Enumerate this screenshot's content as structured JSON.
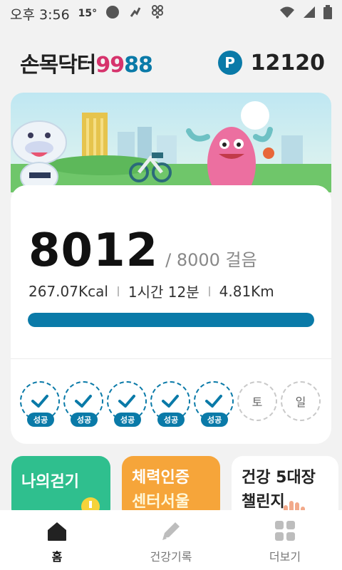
{
  "status_bar": {
    "time": "오후 3:56",
    "temperature": "15°",
    "icons": [
      "circle-icon",
      "activity-icon",
      "app-grid-icon",
      "wifi-icon",
      "signal-icon",
      "battery-icon"
    ]
  },
  "header": {
    "logo_part1": "손목닥터",
    "logo_part2": "99",
    "logo_part3": "88",
    "points_badge": "P",
    "points_value": "12120"
  },
  "steps_card": {
    "steps": "8012",
    "goal_text": "/ 8000 걸음",
    "calories": "267.07Kcal",
    "duration": "1시간 12분",
    "distance": "4.81Km",
    "progress_fraction": 1.0
  },
  "week": {
    "success_label": "성공",
    "days": [
      {
        "status": "success",
        "label": ""
      },
      {
        "status": "success",
        "label": ""
      },
      {
        "status": "success",
        "label": ""
      },
      {
        "status": "success",
        "label": ""
      },
      {
        "status": "success",
        "label": ""
      },
      {
        "status": "pending",
        "label": "토"
      },
      {
        "status": "pending",
        "label": "일"
      }
    ]
  },
  "tiles": {
    "walk": "나의걷기",
    "fitness_line1": "체력인증",
    "fitness_line2": "센터서울",
    "challenge_line1": "건강 5대장",
    "challenge_line2": "챌린지"
  },
  "bottom_nav": {
    "home": "홈",
    "health_record": "건강기록",
    "more": "더보기"
  },
  "colors": {
    "accent": "#0a7aa8",
    "brand_pink": "#d6336c",
    "tile_green": "#2fbf8e",
    "tile_orange": "#f6a53a"
  }
}
